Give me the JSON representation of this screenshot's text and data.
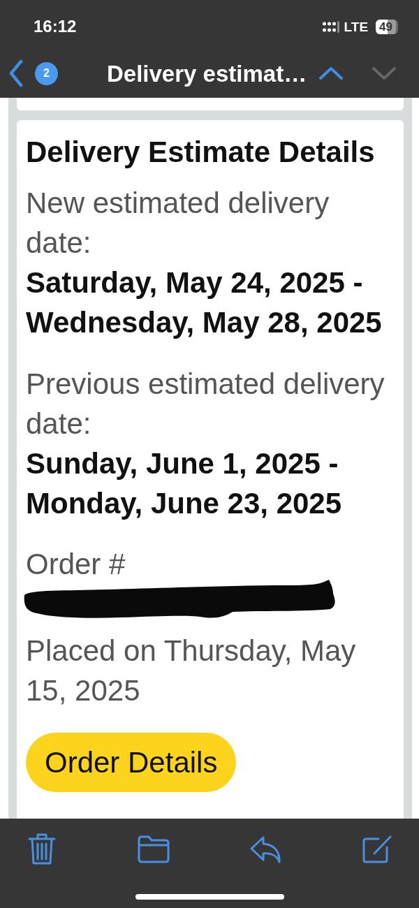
{
  "status_bar": {
    "time": "16:12",
    "network": "LTE",
    "battery": "49"
  },
  "nav_bar": {
    "back_badge": "2",
    "title": "Delivery estimat…",
    "previous": {
      "disabled": false
    },
    "next": {
      "disabled": true
    }
  },
  "message": {
    "title": "Delivery Estimate Details",
    "sections": [
      {
        "label": "New estimated delivery date:",
        "value": "Saturday, May 24, 2025 - Wednesday, May 28, 2025"
      },
      {
        "label": "Previous estimated delivery date:",
        "value": "Sunday, June 1, 2025 - Monday, June 23, 2025"
      }
    ],
    "order": {
      "label": "Order #",
      "redacted": true,
      "placed": "Placed on Thursday, May 15, 2025"
    },
    "button": "Order Details"
  }
}
